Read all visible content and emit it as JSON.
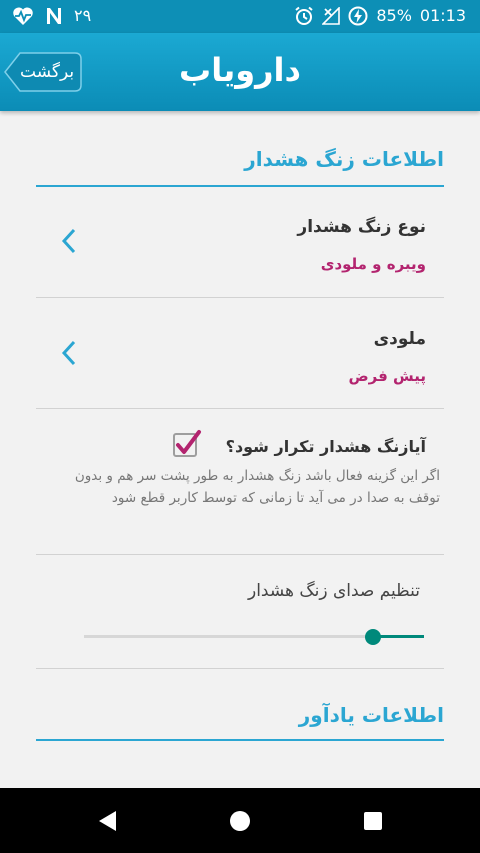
{
  "status_bar": {
    "left_icons": [
      "heart-pulse-icon",
      "n-notification-icon"
    ],
    "left_number": "۲۹",
    "right_icons": [
      "alarm-icon",
      "signal-off-icon",
      "charging-icon"
    ],
    "battery": "85%",
    "time": "01:13"
  },
  "app_bar": {
    "back_label": "برگشت",
    "logo_text": "دارویاب"
  },
  "section_alarm": {
    "title": "اطلاعات زنگ هشدار"
  },
  "alarm_type": {
    "title": "نوع زنگ هشدار",
    "value": "ویبره و ملودی"
  },
  "melody": {
    "title": "ملودی",
    "value": "پیش فرض"
  },
  "repeat": {
    "title": "آیازنگ هشدار تکرار شود؟",
    "checked": true,
    "summary": "اگر این گزینه فعال باشد زنگ هشدار به طور پشت سر هم و بدون توقف به صدا در می آید تا زمانی که توسط کاربر قطع شود"
  },
  "volume": {
    "title": "تنظیم صدای زنگ هشدار",
    "level": 0.85
  },
  "section_reminder": {
    "title": "اطلاعات  یادآور"
  },
  "nav_bar": {
    "back_icon": "triangle-back-icon",
    "home_icon": "circle-home-icon",
    "recents_icon": "square-recents-icon"
  },
  "colors": {
    "status_bar": "#0d8fb6",
    "app_bar": "#1ba9d3",
    "accent": "#2ba6d2",
    "value_text": "#b3246f",
    "slider": "#00897b",
    "background": "#f2f2f2"
  }
}
